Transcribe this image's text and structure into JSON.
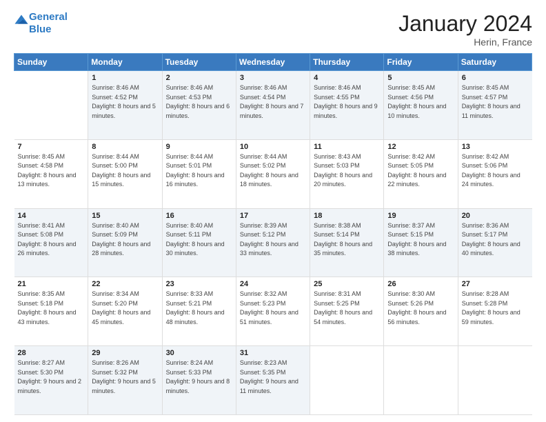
{
  "header": {
    "logo_line1": "General",
    "logo_line2": "Blue",
    "month_title": "January 2024",
    "location": "Herin, France"
  },
  "weekdays": [
    "Sunday",
    "Monday",
    "Tuesday",
    "Wednesday",
    "Thursday",
    "Friday",
    "Saturday"
  ],
  "weeks": [
    [
      {
        "day": "",
        "sunrise": "",
        "sunset": "",
        "daylight": ""
      },
      {
        "day": "1",
        "sunrise": "Sunrise: 8:46 AM",
        "sunset": "Sunset: 4:52 PM",
        "daylight": "Daylight: 8 hours and 5 minutes."
      },
      {
        "day": "2",
        "sunrise": "Sunrise: 8:46 AM",
        "sunset": "Sunset: 4:53 PM",
        "daylight": "Daylight: 8 hours and 6 minutes."
      },
      {
        "day": "3",
        "sunrise": "Sunrise: 8:46 AM",
        "sunset": "Sunset: 4:54 PM",
        "daylight": "Daylight: 8 hours and 7 minutes."
      },
      {
        "day": "4",
        "sunrise": "Sunrise: 8:46 AM",
        "sunset": "Sunset: 4:55 PM",
        "daylight": "Daylight: 8 hours and 9 minutes."
      },
      {
        "day": "5",
        "sunrise": "Sunrise: 8:45 AM",
        "sunset": "Sunset: 4:56 PM",
        "daylight": "Daylight: 8 hours and 10 minutes."
      },
      {
        "day": "6",
        "sunrise": "Sunrise: 8:45 AM",
        "sunset": "Sunset: 4:57 PM",
        "daylight": "Daylight: 8 hours and 11 minutes."
      }
    ],
    [
      {
        "day": "7",
        "sunrise": "Sunrise: 8:45 AM",
        "sunset": "Sunset: 4:58 PM",
        "daylight": "Daylight: 8 hours and 13 minutes."
      },
      {
        "day": "8",
        "sunrise": "Sunrise: 8:44 AM",
        "sunset": "Sunset: 5:00 PM",
        "daylight": "Daylight: 8 hours and 15 minutes."
      },
      {
        "day": "9",
        "sunrise": "Sunrise: 8:44 AM",
        "sunset": "Sunset: 5:01 PM",
        "daylight": "Daylight: 8 hours and 16 minutes."
      },
      {
        "day": "10",
        "sunrise": "Sunrise: 8:44 AM",
        "sunset": "Sunset: 5:02 PM",
        "daylight": "Daylight: 8 hours and 18 minutes."
      },
      {
        "day": "11",
        "sunrise": "Sunrise: 8:43 AM",
        "sunset": "Sunset: 5:03 PM",
        "daylight": "Daylight: 8 hours and 20 minutes."
      },
      {
        "day": "12",
        "sunrise": "Sunrise: 8:42 AM",
        "sunset": "Sunset: 5:05 PM",
        "daylight": "Daylight: 8 hours and 22 minutes."
      },
      {
        "day": "13",
        "sunrise": "Sunrise: 8:42 AM",
        "sunset": "Sunset: 5:06 PM",
        "daylight": "Daylight: 8 hours and 24 minutes."
      }
    ],
    [
      {
        "day": "14",
        "sunrise": "Sunrise: 8:41 AM",
        "sunset": "Sunset: 5:08 PM",
        "daylight": "Daylight: 8 hours and 26 minutes."
      },
      {
        "day": "15",
        "sunrise": "Sunrise: 8:40 AM",
        "sunset": "Sunset: 5:09 PM",
        "daylight": "Daylight: 8 hours and 28 minutes."
      },
      {
        "day": "16",
        "sunrise": "Sunrise: 8:40 AM",
        "sunset": "Sunset: 5:11 PM",
        "daylight": "Daylight: 8 hours and 30 minutes."
      },
      {
        "day": "17",
        "sunrise": "Sunrise: 8:39 AM",
        "sunset": "Sunset: 5:12 PM",
        "daylight": "Daylight: 8 hours and 33 minutes."
      },
      {
        "day": "18",
        "sunrise": "Sunrise: 8:38 AM",
        "sunset": "Sunset: 5:14 PM",
        "daylight": "Daylight: 8 hours and 35 minutes."
      },
      {
        "day": "19",
        "sunrise": "Sunrise: 8:37 AM",
        "sunset": "Sunset: 5:15 PM",
        "daylight": "Daylight: 8 hours and 38 minutes."
      },
      {
        "day": "20",
        "sunrise": "Sunrise: 8:36 AM",
        "sunset": "Sunset: 5:17 PM",
        "daylight": "Daylight: 8 hours and 40 minutes."
      }
    ],
    [
      {
        "day": "21",
        "sunrise": "Sunrise: 8:35 AM",
        "sunset": "Sunset: 5:18 PM",
        "daylight": "Daylight: 8 hours and 43 minutes."
      },
      {
        "day": "22",
        "sunrise": "Sunrise: 8:34 AM",
        "sunset": "Sunset: 5:20 PM",
        "daylight": "Daylight: 8 hours and 45 minutes."
      },
      {
        "day": "23",
        "sunrise": "Sunrise: 8:33 AM",
        "sunset": "Sunset: 5:21 PM",
        "daylight": "Daylight: 8 hours and 48 minutes."
      },
      {
        "day": "24",
        "sunrise": "Sunrise: 8:32 AM",
        "sunset": "Sunset: 5:23 PM",
        "daylight": "Daylight: 8 hours and 51 minutes."
      },
      {
        "day": "25",
        "sunrise": "Sunrise: 8:31 AM",
        "sunset": "Sunset: 5:25 PM",
        "daylight": "Daylight: 8 hours and 54 minutes."
      },
      {
        "day": "26",
        "sunrise": "Sunrise: 8:30 AM",
        "sunset": "Sunset: 5:26 PM",
        "daylight": "Daylight: 8 hours and 56 minutes."
      },
      {
        "day": "27",
        "sunrise": "Sunrise: 8:28 AM",
        "sunset": "Sunset: 5:28 PM",
        "daylight": "Daylight: 8 hours and 59 minutes."
      }
    ],
    [
      {
        "day": "28",
        "sunrise": "Sunrise: 8:27 AM",
        "sunset": "Sunset: 5:30 PM",
        "daylight": "Daylight: 9 hours and 2 minutes."
      },
      {
        "day": "29",
        "sunrise": "Sunrise: 8:26 AM",
        "sunset": "Sunset: 5:32 PM",
        "daylight": "Daylight: 9 hours and 5 minutes."
      },
      {
        "day": "30",
        "sunrise": "Sunrise: 8:24 AM",
        "sunset": "Sunset: 5:33 PM",
        "daylight": "Daylight: 9 hours and 8 minutes."
      },
      {
        "day": "31",
        "sunrise": "Sunrise: 8:23 AM",
        "sunset": "Sunset: 5:35 PM",
        "daylight": "Daylight: 9 hours and 11 minutes."
      },
      {
        "day": "",
        "sunrise": "",
        "sunset": "",
        "daylight": ""
      },
      {
        "day": "",
        "sunrise": "",
        "sunset": "",
        "daylight": ""
      },
      {
        "day": "",
        "sunrise": "",
        "sunset": "",
        "daylight": ""
      }
    ]
  ]
}
